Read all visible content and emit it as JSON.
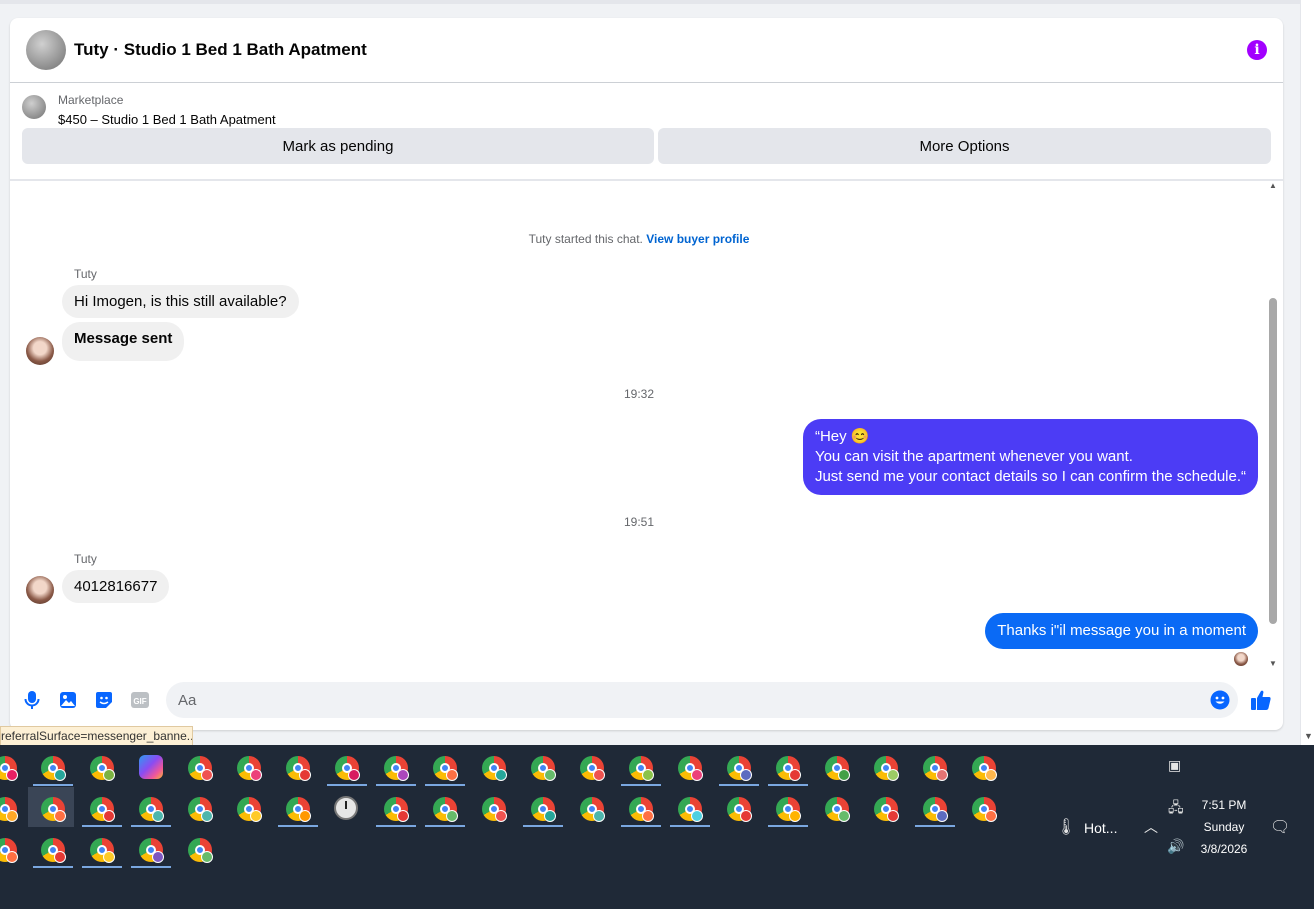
{
  "header": {
    "title": "Tuty · Studio 1 Bed 1 Bath Apatment",
    "info_icon": "info-icon"
  },
  "listing": {
    "label": "Marketplace",
    "price_title": "$450 – Studio 1 Bed 1 Bath Apatment"
  },
  "actions": {
    "pending_label": "Mark as pending",
    "more_label": "More Options"
  },
  "chat": {
    "started_text": "Tuty started this chat.",
    "view_profile_link": "View buyer profile",
    "sender_name_1": "Tuty",
    "msg_in_1": "Hi Imogen, is this still available?",
    "msg_in_2": "Message sent",
    "time_1": "19:32",
    "msg_out_1_line1": "“Hey 😊",
    "msg_out_1_line2": "You can visit the apartment whenever you want.",
    "msg_out_1_line3": "Just send me your contact details so I can confirm the schedule.“",
    "time_2": "19:51",
    "sender_name_2": "Tuty",
    "msg_in_3": "4012816677",
    "msg_out_2": "Thanks i\"il message you in a moment",
    "out_bubble_color_1": "#4c3cf5",
    "out_bubble_color_2": "#0a6af5"
  },
  "composer": {
    "placeholder": "Aa",
    "icons": [
      "microphone-icon",
      "image-icon",
      "sticker-icon",
      "gif-icon",
      "emoji-icon",
      "thumbs-up-icon"
    ],
    "gif_label": "GIF"
  },
  "status_tooltip": "referralSurface=messenger_banne...",
  "taskbar": {
    "weather_label": "Hot...",
    "time": "7:51 PM",
    "day": "Sunday",
    "date": "3/8/2026",
    "accent": "#0866ff"
  }
}
